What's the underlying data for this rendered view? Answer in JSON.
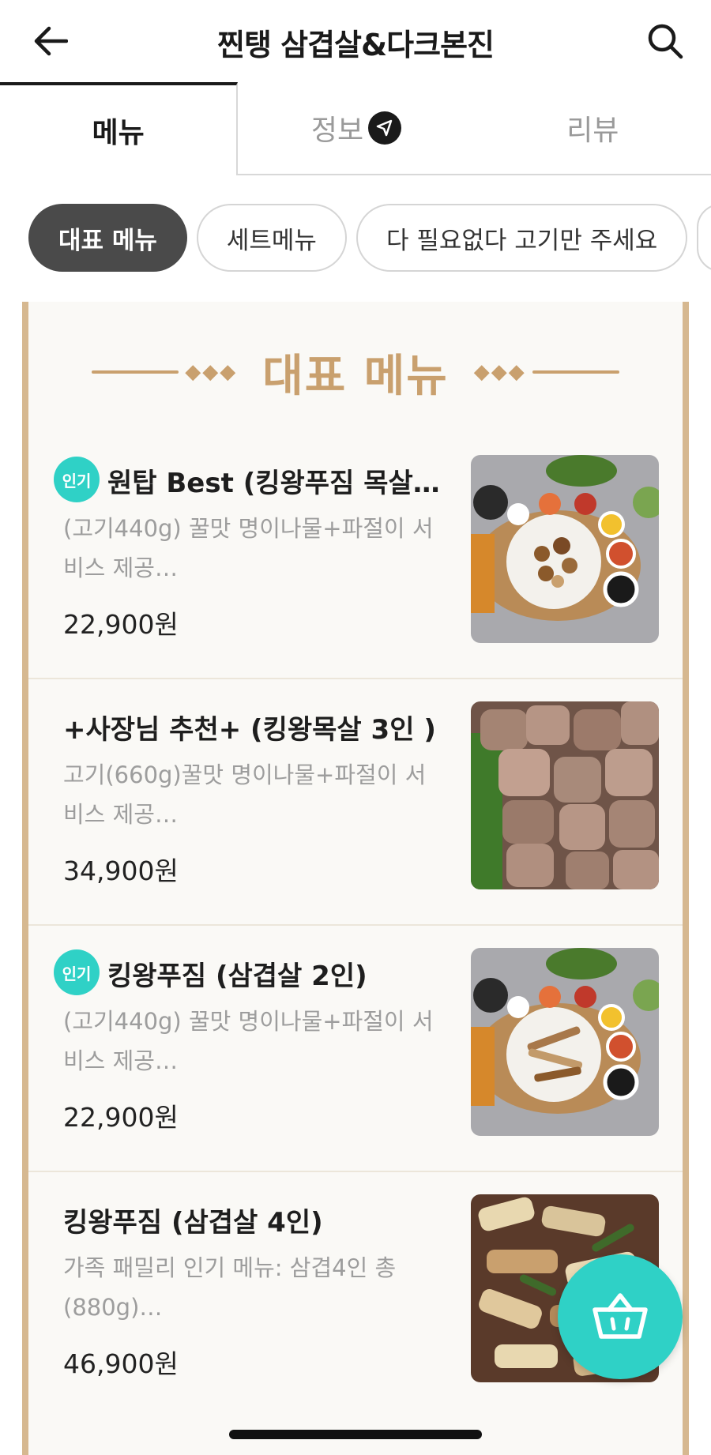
{
  "header": {
    "title": "찐탱 삼겹살&다크본진"
  },
  "tabs": [
    {
      "label": "메뉴"
    },
    {
      "label": "정보"
    },
    {
      "label": "리뷰"
    }
  ],
  "chips": [
    {
      "label": "대표 메뉴"
    },
    {
      "label": "세트메뉴"
    },
    {
      "label": "다 필요없다 고기만 주세요"
    }
  ],
  "section": {
    "title": "대표 메뉴"
  },
  "badge_label": "인기",
  "items": [
    {
      "name": "원탑 Best (킹왕푸짐 목살…",
      "desc": "(고기440g) 꿀맛 명이나물+파절이 서비스 제공…",
      "price": "22,900원",
      "popular": true
    },
    {
      "name": "+사장님 추천+ (킹왕목살  3인 )",
      "desc": "고기(660g)꿀맛 명이나물+파절이 서비스 제공…",
      "price": "34,900원",
      "popular": false
    },
    {
      "name": "킹왕푸짐 (삼겹살 2인)",
      "desc": "(고기440g) 꿀맛 명이나물+파절이 서비스 제공…",
      "price": "22,900원",
      "popular": true
    },
    {
      "name": "킹왕푸짐 (삼겹살 4인)",
      "desc": "가족 패밀리 인기 메뉴: 삼겹4인 총 (880g)…",
      "price": "46,900원",
      "popular": false
    }
  ],
  "colors": {
    "accent": "#2fd1c6",
    "gold": "#c9a06e",
    "chip_active": "#4a4a4a"
  },
  "icons": [
    "back-arrow-icon",
    "search-icon",
    "navigation-icon",
    "cart-icon"
  ]
}
